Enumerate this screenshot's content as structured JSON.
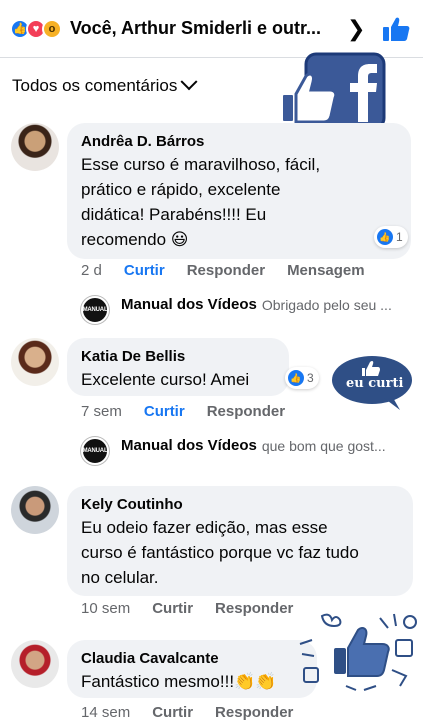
{
  "header": {
    "title": "Você, Arthur Smiderli e outr...",
    "reactions": [
      "like",
      "love",
      "wow"
    ]
  },
  "filter": {
    "label": "Todos os comentários"
  },
  "badges": {
    "eu_curti": "eu curti"
  },
  "colors": {
    "accent": "#1877f2",
    "bubble": "#f0f2f5",
    "muted": "#65676b"
  },
  "comments": [
    {
      "author": "Andrêa D. Bárros",
      "lines": [
        "Esse curso é maravilhoso, fácil,",
        "prático e rápido, excelente",
        "didática! Parabéns!!!! Eu",
        "recomendo 😃"
      ],
      "reaction_count": "1",
      "time": "2 d",
      "like_label": "Curtir",
      "reply_label": "Responder",
      "message_label": "Mensagem",
      "reply": {
        "author": "Manual dos Vídeos",
        "text": "Obrigado pelo seu ..."
      }
    },
    {
      "author": "Katia De Bellis",
      "lines": [
        "Excelente curso! Amei"
      ],
      "reaction_count": "3",
      "time": "7 sem",
      "like_label": "Curtir",
      "reply_label": "Responder",
      "reply": {
        "author": "Manual dos Vídeos",
        "text": "que bom que gost..."
      }
    },
    {
      "author": "Kely Coutinho",
      "lines": [
        "Eu odeio fazer edição, mas esse",
        "curso é fantástico porque vc faz tudo",
        "no celular."
      ],
      "time": "10 sem",
      "like_label": "Curtir",
      "reply_label": "Responder"
    },
    {
      "author": "Claudia Cavalcante",
      "lines": [
        "Fantástico mesmo!!!👏👏"
      ],
      "time": "14 sem",
      "like_label": "Curtir",
      "reply_label": "Responder"
    }
  ],
  "reply_avatar_label": "MANUAL"
}
